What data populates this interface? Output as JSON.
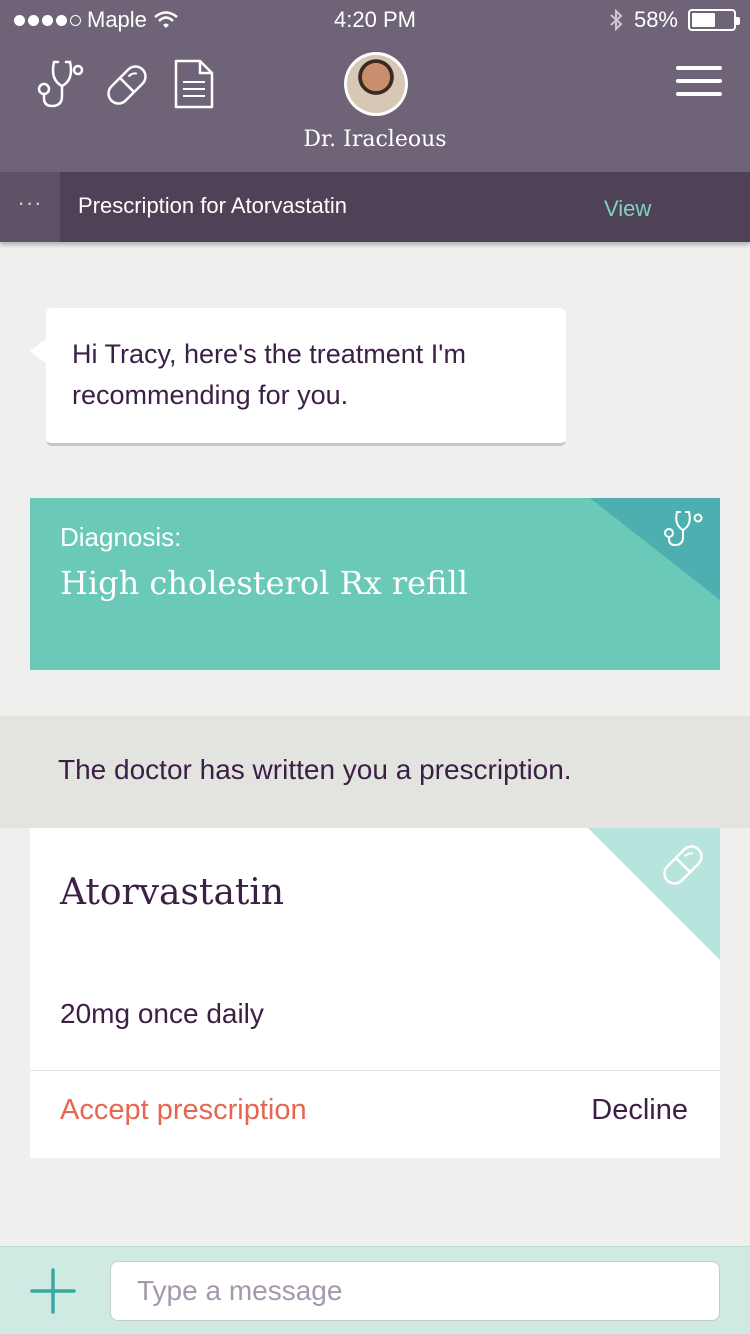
{
  "status_bar": {
    "carrier": "Maple",
    "time": "4:20 PM",
    "battery_text": "58%",
    "battery_level": 0.58,
    "signal_bars_filled": 4,
    "signal_bars_total": 5
  },
  "header": {
    "icons": [
      "stethoscope-icon",
      "pill-icon",
      "document-icon",
      "menu-icon"
    ],
    "doctor_name": "Dr. Iracleous",
    "background_color": "#6f6477"
  },
  "subheader": {
    "more_label": "···",
    "title": "Prescription for Atorvastatin",
    "view_label": "View",
    "background_color": "#4f4256"
  },
  "chat": {
    "message": "Hi Tracy, here's the treatment I'm recommending for you."
  },
  "diagnosis": {
    "label": "Diagnosis:",
    "value": "High cholesterol Rx refill",
    "background_color": "#6bc9b8",
    "icon": "stethoscope-icon"
  },
  "banner": {
    "text": "The doctor has written you a prescription."
  },
  "prescription": {
    "name": "Atorvastatin",
    "dosage": "20mg once daily",
    "accept_label": "Accept prescription",
    "decline_label": "Decline",
    "accept_color": "#e5674f",
    "icon": "pill-icon"
  },
  "composer": {
    "placeholder": "Type a message",
    "value": "",
    "add_icon": "plus-icon"
  }
}
